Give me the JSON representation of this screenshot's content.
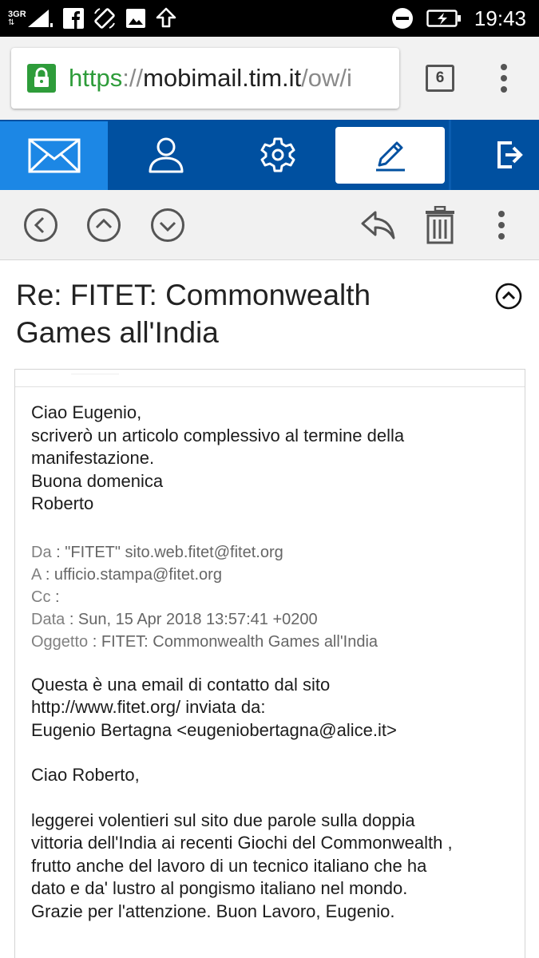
{
  "status_bar": {
    "network": "3G",
    "network_sub": "R",
    "time": "19:43",
    "icons": [
      "signal-icon",
      "facebook-icon",
      "rotation-icon",
      "image-icon",
      "upload-icon",
      "dnd-icon",
      "battery-charging-icon"
    ]
  },
  "browser": {
    "url_scheme": "https",
    "url_separator": "://",
    "url_host": "mobimail.tim.it",
    "url_path": "/ow/i",
    "tab_count": "6"
  },
  "app_nav": {
    "items": [
      "mail-icon",
      "contacts-icon",
      "settings-icon",
      "compose-icon",
      "logout-icon"
    ],
    "active": "mail",
    "colors": {
      "bar": "#0050a0",
      "active": "#1c87e5"
    }
  },
  "toolbar": {
    "buttons": [
      "back-icon",
      "previous-icon",
      "next-icon",
      "reply-icon",
      "delete-icon",
      "more-icon"
    ]
  },
  "message": {
    "subject_line1": "Re: FITET: Commonwealth",
    "subject_line2": "Games all'India",
    "reply": [
      "Ciao Eugenio,",
      "scriverò un articolo complessivo al termine della",
      "manifestazione.",
      "Buona domenica",
      "Roberto"
    ],
    "headers": {
      "from_label": "Da",
      "from_value": ": \"FITET\" sito.web.fitet@fitet.org",
      "to_label": "A",
      "to_value": ": ufficio.stampa@fitet.org",
      "cc_label": "Cc",
      "cc_value": ":",
      "date_label": "Data",
      "date_value": ": Sun, 15 Apr 2018 13:57:41 +0200",
      "subject_label": "Oggetto",
      "subject_value": ": FITET: Commonwealth Games all'India"
    },
    "quoted_intro": [
      "Questa è una email di contatto dal sito",
      "http://www.fitet.org/ inviata da:",
      "Eugenio Bertagna <eugeniobertagna@alice.it>"
    ],
    "quoted_greeting": "Ciao Roberto,",
    "quoted_body": [
      "leggerei volentieri sul sito due parole sulla doppia",
      "vittoria dell'India ai recenti Giochi del Commonwealth ,",
      "frutto anche del lavoro di un tecnico italiano che ha",
      "dato e da' lustro al pongismo italiano nel mondo.",
      "Grazie per l'attenzione. Buon Lavoro, Eugenio."
    ]
  }
}
